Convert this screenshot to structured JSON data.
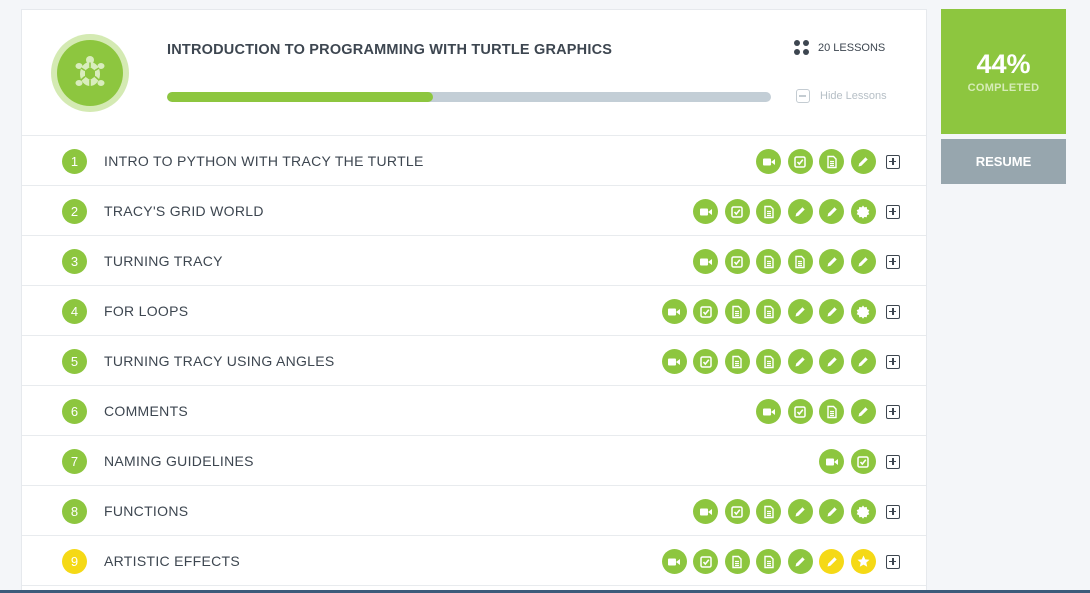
{
  "course": {
    "title": "INTRODUCTION TO PROGRAMMING WITH TURTLE GRAPHICS",
    "lesson_count": "20 LESSONS",
    "hide_lessons": "Hide Lessons",
    "progress_fraction": 0.44
  },
  "sidebar": {
    "percent": "44%",
    "percent_label": "COMPLETED",
    "resume": "RESUME"
  },
  "colors": {
    "accent": "#8dc63f",
    "current": "#f5d916",
    "text": "#3d4650",
    "resume_bg": "#97a6ae"
  },
  "lessons": [
    {
      "number": "1",
      "title": "INTRO TO PYTHON WITH TRACY THE TURTLE",
      "status": "done",
      "items": [
        [
          "video",
          "done"
        ],
        [
          "check",
          "done"
        ],
        [
          "doc",
          "done"
        ],
        [
          "pencil",
          "done"
        ]
      ]
    },
    {
      "number": "2",
      "title": "TRACY'S GRID WORLD",
      "status": "done",
      "items": [
        [
          "video",
          "done"
        ],
        [
          "check",
          "done"
        ],
        [
          "doc",
          "done"
        ],
        [
          "pencil",
          "done"
        ],
        [
          "pencil",
          "done"
        ],
        [
          "badge",
          "done"
        ]
      ]
    },
    {
      "number": "3",
      "title": "TURNING TRACY",
      "status": "done",
      "items": [
        [
          "video",
          "done"
        ],
        [
          "check",
          "done"
        ],
        [
          "doc",
          "done"
        ],
        [
          "doc",
          "done"
        ],
        [
          "pencil",
          "done"
        ],
        [
          "pencil",
          "done"
        ]
      ]
    },
    {
      "number": "4",
      "title": "FOR LOOPS",
      "status": "done",
      "items": [
        [
          "video",
          "done"
        ],
        [
          "check",
          "done"
        ],
        [
          "doc",
          "done"
        ],
        [
          "doc",
          "done"
        ],
        [
          "pencil",
          "done"
        ],
        [
          "pencil",
          "done"
        ],
        [
          "badge",
          "done"
        ]
      ]
    },
    {
      "number": "5",
      "title": "TURNING TRACY USING ANGLES",
      "status": "done",
      "items": [
        [
          "video",
          "done"
        ],
        [
          "check",
          "done"
        ],
        [
          "doc",
          "done"
        ],
        [
          "doc",
          "done"
        ],
        [
          "pencil",
          "done"
        ],
        [
          "pencil",
          "done"
        ],
        [
          "pencil",
          "done"
        ]
      ]
    },
    {
      "number": "6",
      "title": "COMMENTS",
      "status": "done",
      "items": [
        [
          "video",
          "done"
        ],
        [
          "check",
          "done"
        ],
        [
          "doc",
          "done"
        ],
        [
          "pencil",
          "done"
        ]
      ]
    },
    {
      "number": "7",
      "title": "NAMING GUIDELINES",
      "status": "done",
      "items": [
        [
          "video",
          "done"
        ],
        [
          "check",
          "done"
        ]
      ]
    },
    {
      "number": "8",
      "title": "FUNCTIONS",
      "status": "done",
      "items": [
        [
          "video",
          "done"
        ],
        [
          "check",
          "done"
        ],
        [
          "doc",
          "done"
        ],
        [
          "pencil",
          "done"
        ],
        [
          "pencil",
          "done"
        ],
        [
          "badge",
          "done"
        ]
      ]
    },
    {
      "number": "9",
      "title": "ARTISTIC EFFECTS",
      "status": "current",
      "items": [
        [
          "video",
          "done"
        ],
        [
          "check",
          "done"
        ],
        [
          "doc",
          "done"
        ],
        [
          "doc",
          "done"
        ],
        [
          "pencil",
          "done"
        ],
        [
          "pencil",
          "current"
        ],
        [
          "star",
          "current"
        ]
      ]
    }
  ]
}
